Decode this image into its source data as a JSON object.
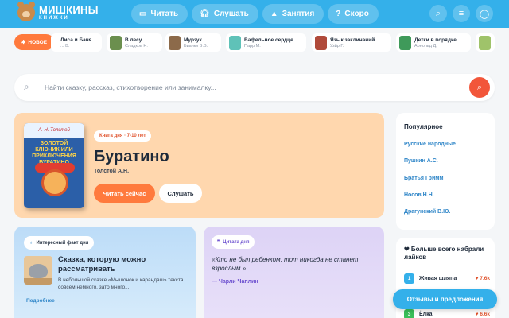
{
  "header": {
    "logo_title": "МИШКИНЫ",
    "logo_sub": "КНИЖКИ",
    "nav": [
      {
        "label": "Читать",
        "icon": "book-icon"
      },
      {
        "label": "Слушать",
        "icon": "headphones-icon"
      },
      {
        "label": "Занятия",
        "icon": "graduation-cap-icon"
      },
      {
        "label": "Скоро",
        "icon": "question-icon"
      }
    ]
  },
  "new_books": {
    "badge": "НОВОЕ",
    "items": [
      {
        "title": "Лиса и Баня",
        "author": "... В."
      },
      {
        "title": "В лесу",
        "author": "Сладков Н."
      },
      {
        "title": "Мурзук",
        "author": "Бианки В.В."
      },
      {
        "title": "Вафельное сердце",
        "author": "Парр М."
      },
      {
        "title": "Язык заклинаний",
        "author": "Узйр Г."
      },
      {
        "title": "Детки в порядке",
        "author": "Арнольд Д."
      }
    ]
  },
  "search": {
    "placeholder": "Найти сказку, рассказ, стихотворение или занималку..."
  },
  "book_of_day": {
    "badge": "Книга дня · 7-10 лет",
    "title": "Буратино",
    "author": "Толстой А.Н.",
    "read_label": "Читать сейчас",
    "listen_label": "Слушать",
    "cover_author": "А. Н. Толстой",
    "cover_title": "ЗОЛОТОЙ КЛЮЧИК ИЛИ ПРИКЛЮЧЕНИЯ БУРАТИНО"
  },
  "popular": {
    "title": "Популярное",
    "items": [
      "Русские народные",
      "Пушкин А.С.",
      "Братья Гримм",
      "Носов Н.Н.",
      "Драгунский В.Ю."
    ]
  },
  "fact": {
    "badge": "Интересный факт дня",
    "title": "Сказка, которую можно рассматривать",
    "text": "В небольшой сказке «Мышонок и карандаш» текста совсем немного, зато много...",
    "more": "Подробнее →"
  },
  "quote": {
    "badge": "Цитата дня",
    "text": "«Кто не был ребенком, тот никогда не станет взрослым.»",
    "author": "— Чарли Чаплин"
  },
  "liked": {
    "title": "❤ Больше всего набрали лайков",
    "items": [
      {
        "rank": "1",
        "name": "Живая шляпа",
        "count": "♥ 7.6k",
        "color": "#34b0ea"
      },
      {
        "rank": "3",
        "name": "Ёлка",
        "count": "♥ 6.6k",
        "color": "#3bbf5a"
      }
    ]
  },
  "feedback_label": "Отзывы и предложения",
  "colors": {
    "header": "#34b0ea",
    "accent_orange": "#ff7a3d",
    "search_button": "#f2563a",
    "link_blue": "#2f86c8"
  }
}
